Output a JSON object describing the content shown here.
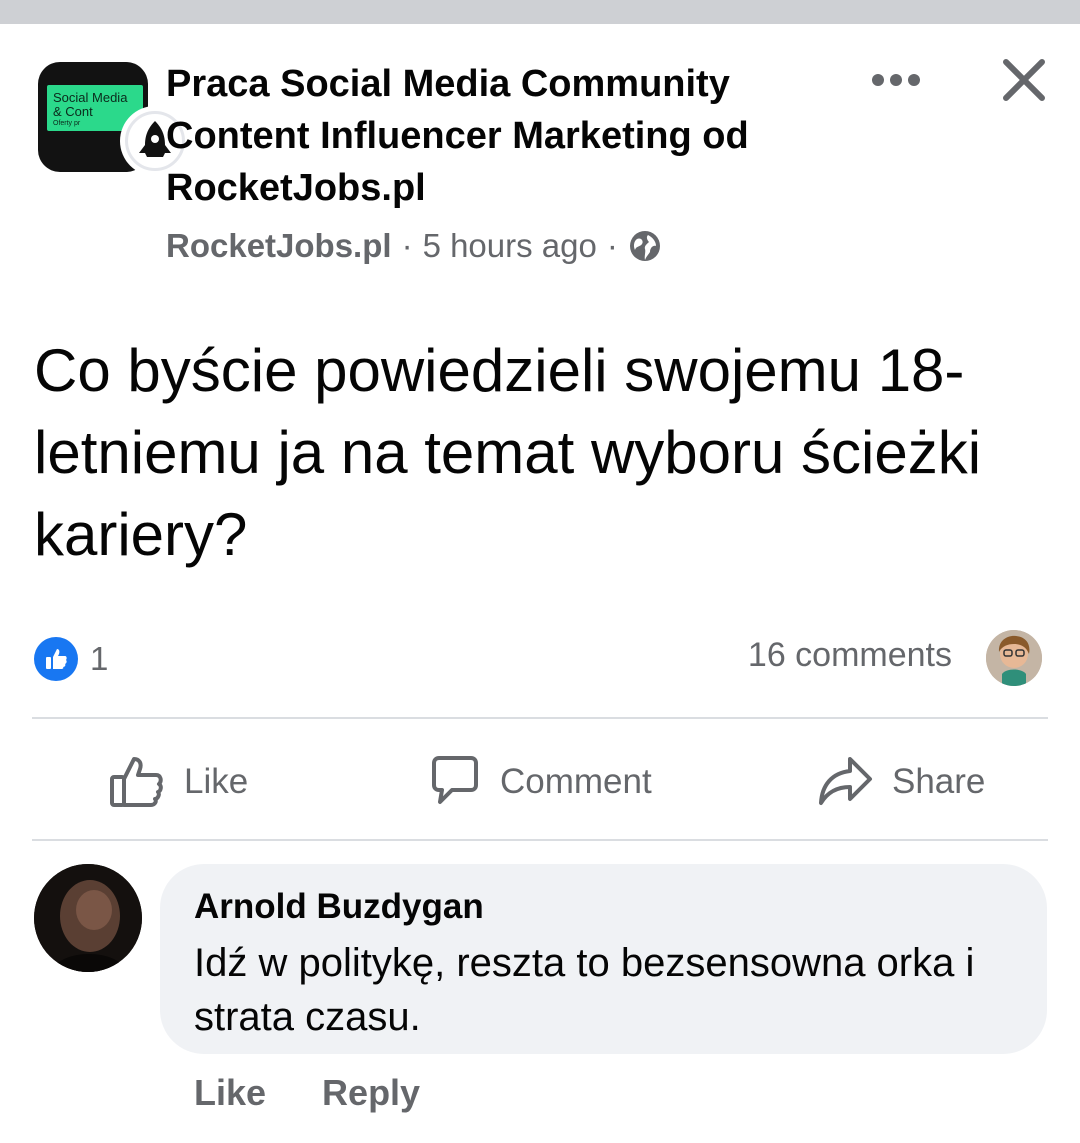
{
  "post": {
    "group_title": "Praca Social Media Community Content Influencer Marketing od RocketJobs.pl",
    "author": "RocketJobs.pl",
    "separator": "·",
    "time": "5 hours ago",
    "text": "Co byście powiedzieli swojemu 18-letniemu ja na temat wyboru ścieżki kariery?",
    "group_avatar": {
      "card_line1": "Social Media",
      "card_line2": "& Cont",
      "card_small": "Oferty pr"
    }
  },
  "reactions": {
    "like_count": "1",
    "comments_count": "16 comments"
  },
  "actions": {
    "like": "Like",
    "comment": "Comment",
    "share": "Share"
  },
  "comment": {
    "author": "Arnold Buzdygan",
    "text": "Idź w politykę, reszta to bezsensowna orka i strata czasu.",
    "like_label": "Like",
    "reply_label": "Reply"
  },
  "colors": {
    "accent": "#1877f2",
    "secondary_text": "#65676b",
    "bubble": "#f0f2f5",
    "avatar_card": "#2bd98b"
  },
  "icons": {
    "more": "more-horizontal-icon",
    "close": "close-icon",
    "privacy": "globe-icon",
    "like": "thumbs-up-icon",
    "comment": "speech-bubble-icon",
    "share": "share-arrow-icon"
  }
}
